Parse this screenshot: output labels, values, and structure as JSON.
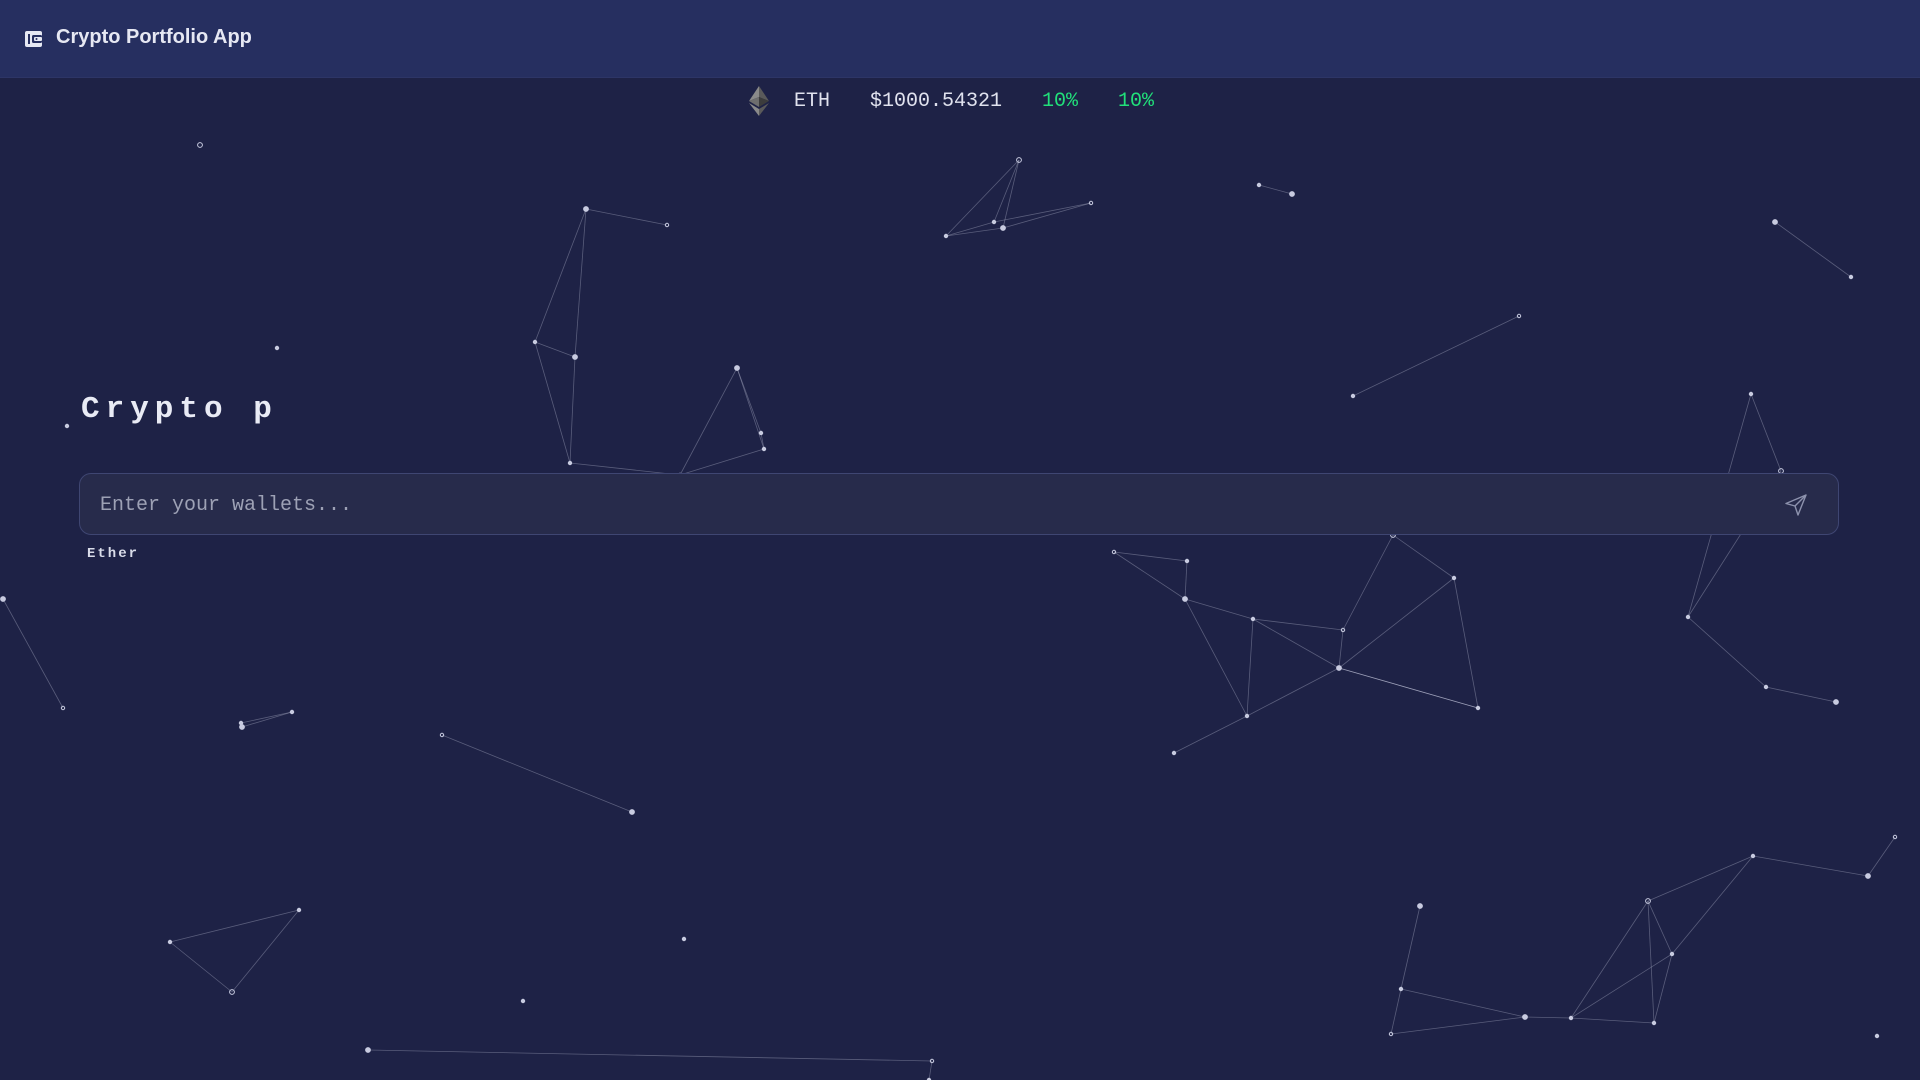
{
  "header": {
    "app_title": "Crypto Portfolio App",
    "icon": "wallet-icon"
  },
  "ticker": {
    "icon": "ethereum-logo-icon",
    "symbol": "ETH",
    "price": "$1000.54321",
    "change_1": "10%",
    "change_2": "10%"
  },
  "main": {
    "heading": "Crypto p",
    "wallet_input": {
      "value": "",
      "placeholder": "Enter your wallets..."
    },
    "send_icon": "send-icon",
    "suggestion": "Ether"
  },
  "colors": {
    "background": "#1e2246",
    "header_bg": "#262f60",
    "input_bg": "#272b4b",
    "positive": "#21e07a",
    "network": "#c8cbe0"
  }
}
